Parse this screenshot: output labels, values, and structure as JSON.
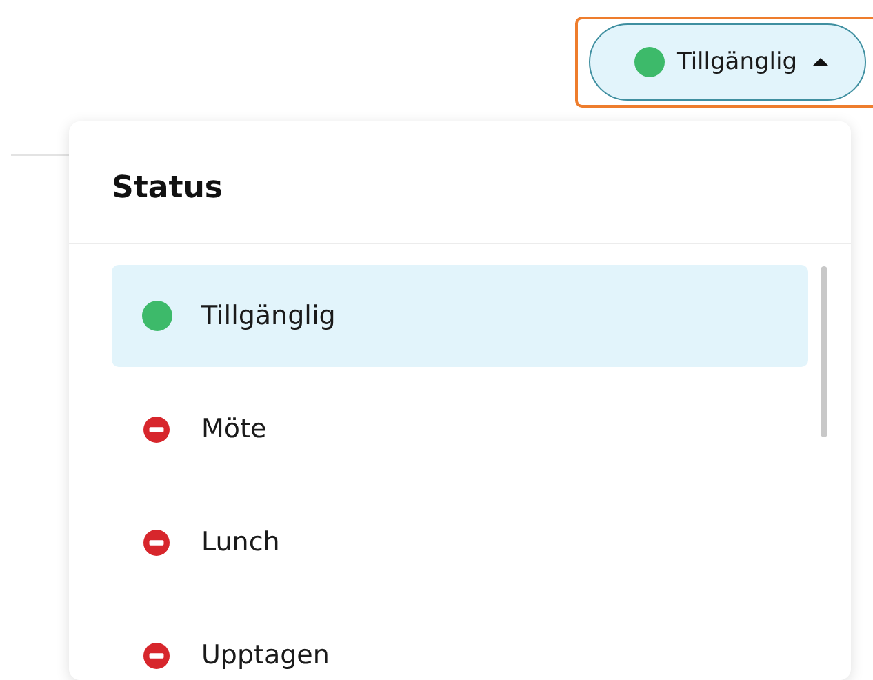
{
  "status_button": {
    "label": "Tillgänglig",
    "kind": "available",
    "expanded": true
  },
  "status_menu": {
    "title": "Status",
    "items": [
      {
        "label": "Tillgänglig",
        "kind": "available",
        "selected": true
      },
      {
        "label": "Möte",
        "kind": "blocked",
        "selected": false
      },
      {
        "label": "Lunch",
        "kind": "blocked",
        "selected": false
      },
      {
        "label": "Upptagen",
        "kind": "blocked",
        "selected": false
      }
    ]
  }
}
